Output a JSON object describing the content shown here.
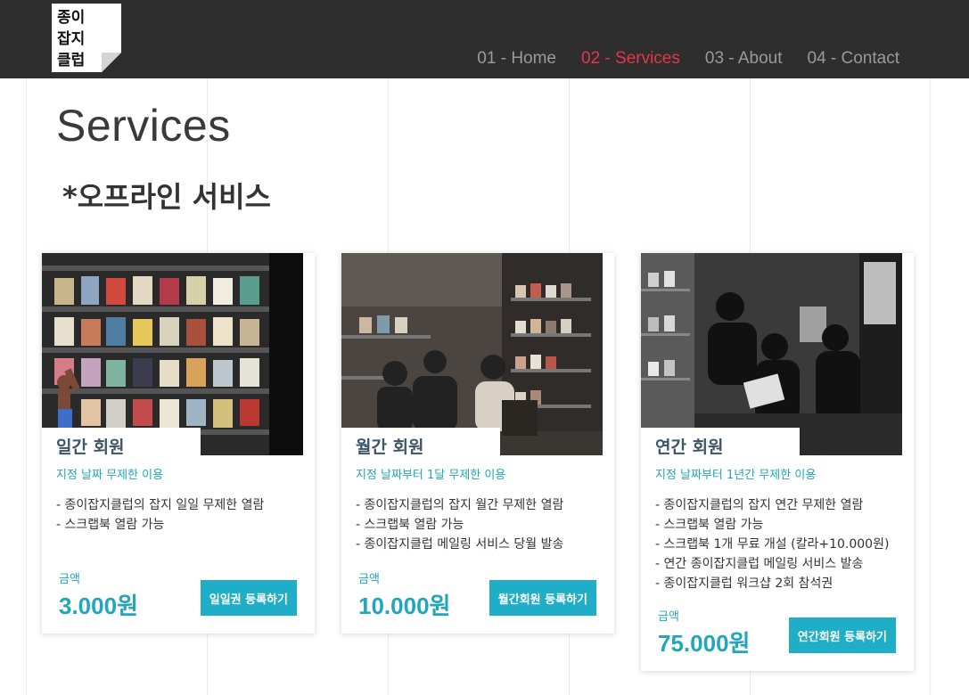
{
  "brand": {
    "logo_lines": [
      "종이",
      "잡지",
      "클럽"
    ]
  },
  "nav": {
    "items": [
      {
        "label": "01 - Home",
        "active": false
      },
      {
        "label": "02 - Services",
        "active": true
      },
      {
        "label": "03 - About",
        "active": false
      },
      {
        "label": "04 - Contact",
        "active": false
      }
    ]
  },
  "page": {
    "title": "Services",
    "section_title": "*오프라인 서비스"
  },
  "cards": [
    {
      "title": "일간 회원",
      "subtitle": "지정 날짜 무제한 이용",
      "features": [
        "- 종이잡지클럽의 잡지 일일 무제한 열람",
        "- 스크랩북 열람 가능"
      ],
      "price_label": "금액",
      "price": "3.000원",
      "button": "일일권 등록하기"
    },
    {
      "title": "월간 회원",
      "subtitle": "지정 날짜부터 1달 무제한 이용",
      "features": [
        "- 종이잡지클럽의 잡지 월간 무제한 열람",
        "- 스크랩북 열람 가능",
        "- 종이잡지클럽 메일링 서비스 당월 발송"
      ],
      "price_label": "금액",
      "price": "10.000원",
      "button": "월간회원 등록하기"
    },
    {
      "title": "연간 회원",
      "subtitle": "지정 날짜부터 1년간 무제한 이용",
      "features": [
        "- 종이잡지클럽의 잡지 연간 무제한 열람",
        "- 스크랩북 열람 가능",
        "- 스크랩북 1개 무료 개설 (칼라+10.000원)",
        "- 연간 종이잡지클럽 메일링 서비스 발송",
        "- 종이잡지클럽 워크샵 2회 참석권"
      ],
      "price_label": "금액",
      "price": "75.000원",
      "button": "연간회원 등록하기"
    }
  ],
  "colors": {
    "navbar_bg": "#2e2e2e",
    "nav_active": "#e5364a",
    "nav_inactive": "#9a9a9a",
    "accent": "#21a6bc",
    "button_bg": "#1eaec7"
  }
}
